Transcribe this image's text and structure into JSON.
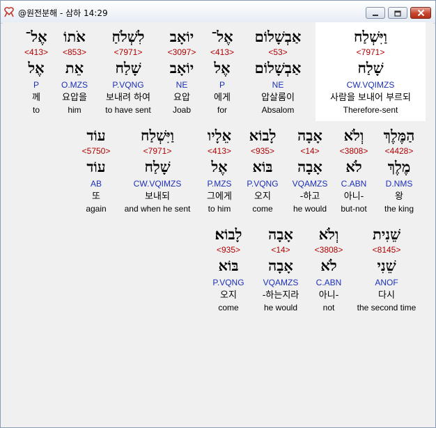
{
  "window": {
    "title": "@원전분해 - 삼하 14:29",
    "icon": "ribbon-icon",
    "controls": [
      "minimize",
      "maximize",
      "close"
    ]
  },
  "rows": [
    {
      "words": [
        {
          "heb": "וַיִּשְׁלַח",
          "strong": "<7971>",
          "lemma": "שָׁלַח",
          "morph": "CW.VQIMZS",
          "korean": "사람을 보내어 부르되",
          "english": "Therefore-sent",
          "highlight": true
        },
        {
          "heb": "אַבְשָׁלוֹם",
          "strong": "<53>",
          "lemma": "אַבְשָׁלוֹם",
          "morph": "NE",
          "korean": "압살롬이",
          "english": "Absalom"
        },
        {
          "heb": "אֶל־",
          "strong": "<413>",
          "lemma": "אֶל",
          "morph": "P",
          "korean": "에게",
          "english": "for"
        },
        {
          "heb": "יוֹאָב",
          "strong": "<3097>",
          "lemma": "יוֹאָב",
          "morph": "NE",
          "korean": "요압",
          "english": "Joab"
        },
        {
          "heb": "לִשְׁלֹחַ",
          "strong": "<7971>",
          "lemma": "שָׁלַח",
          "morph": "P.VQNG",
          "korean": "보내려 하여",
          "english": "to have sent"
        },
        {
          "heb": "אֹתוֹ",
          "strong": "<853>",
          "lemma": "אֵת",
          "morph": "O.MZS",
          "korean": "요압을",
          "english": "him"
        },
        {
          "heb": "אֶל־",
          "strong": "<413>",
          "lemma": "אֶל",
          "morph": "P",
          "korean": "께",
          "english": "to"
        }
      ]
    },
    {
      "words": [
        {
          "heb": "הַמֶּלֶךְ",
          "strong": "<4428>",
          "lemma": "מֶלֶךְ",
          "morph": "D.NMS",
          "korean": "왕",
          "english": "the king"
        },
        {
          "heb": "וְלֹא",
          "strong": "<3808>",
          "lemma": "לֹא",
          "morph": "C.ABN",
          "korean": "아니-",
          "english": "but-not"
        },
        {
          "heb": "אָבָה",
          "strong": "<14>",
          "lemma": "אָבָה",
          "morph": "VQAMZS",
          "korean": "-하고",
          "english": "he would"
        },
        {
          "heb": "לָבוֹא",
          "strong": "<935>",
          "lemma": "בּוֹא",
          "morph": "P.VQNG",
          "korean": "오지",
          "english": "come"
        },
        {
          "heb": "אֵלָיו",
          "strong": "<413>",
          "lemma": "אֶל",
          "morph": "P.MZS",
          "korean": "그에게",
          "english": "to him"
        },
        {
          "heb": "וַיִּשְׁלַח",
          "strong": "<7971>",
          "lemma": "שָׁלַח",
          "morph": "CW.VQIMZS",
          "korean": "보내되",
          "english": "and when he sent"
        },
        {
          "heb": "עוֹד",
          "strong": "<5750>",
          "lemma": "עוֹד",
          "morph": "AB",
          "korean": "또",
          "english": "again"
        }
      ]
    },
    {
      "words": [
        {
          "heb": "שֵׁנִית",
          "strong": "<8145>",
          "lemma": "שֵׁנִי",
          "morph": "ANOF",
          "korean": "다시",
          "english": "the second time"
        },
        {
          "heb": "וְלֹא",
          "strong": "<3808>",
          "lemma": "לֹא",
          "morph": "C.ABN",
          "korean": "아니-",
          "english": "not"
        },
        {
          "heb": "אָבָה",
          "strong": "<14>",
          "lemma": "אָבָה",
          "morph": "VQAMZS",
          "korean": "-하는지라",
          "english": "he would"
        },
        {
          "heb": "לָבוֹא׃",
          "strong": "<935>",
          "lemma": "בּוֹא",
          "morph": "P.VQNG",
          "korean": "오지",
          "english": "come"
        }
      ]
    }
  ],
  "colors": {
    "strong": "#b00000",
    "morph": "#1c2fb8",
    "text": "#000000",
    "highlight": "#ffffff",
    "background": "#f0f0f0"
  }
}
